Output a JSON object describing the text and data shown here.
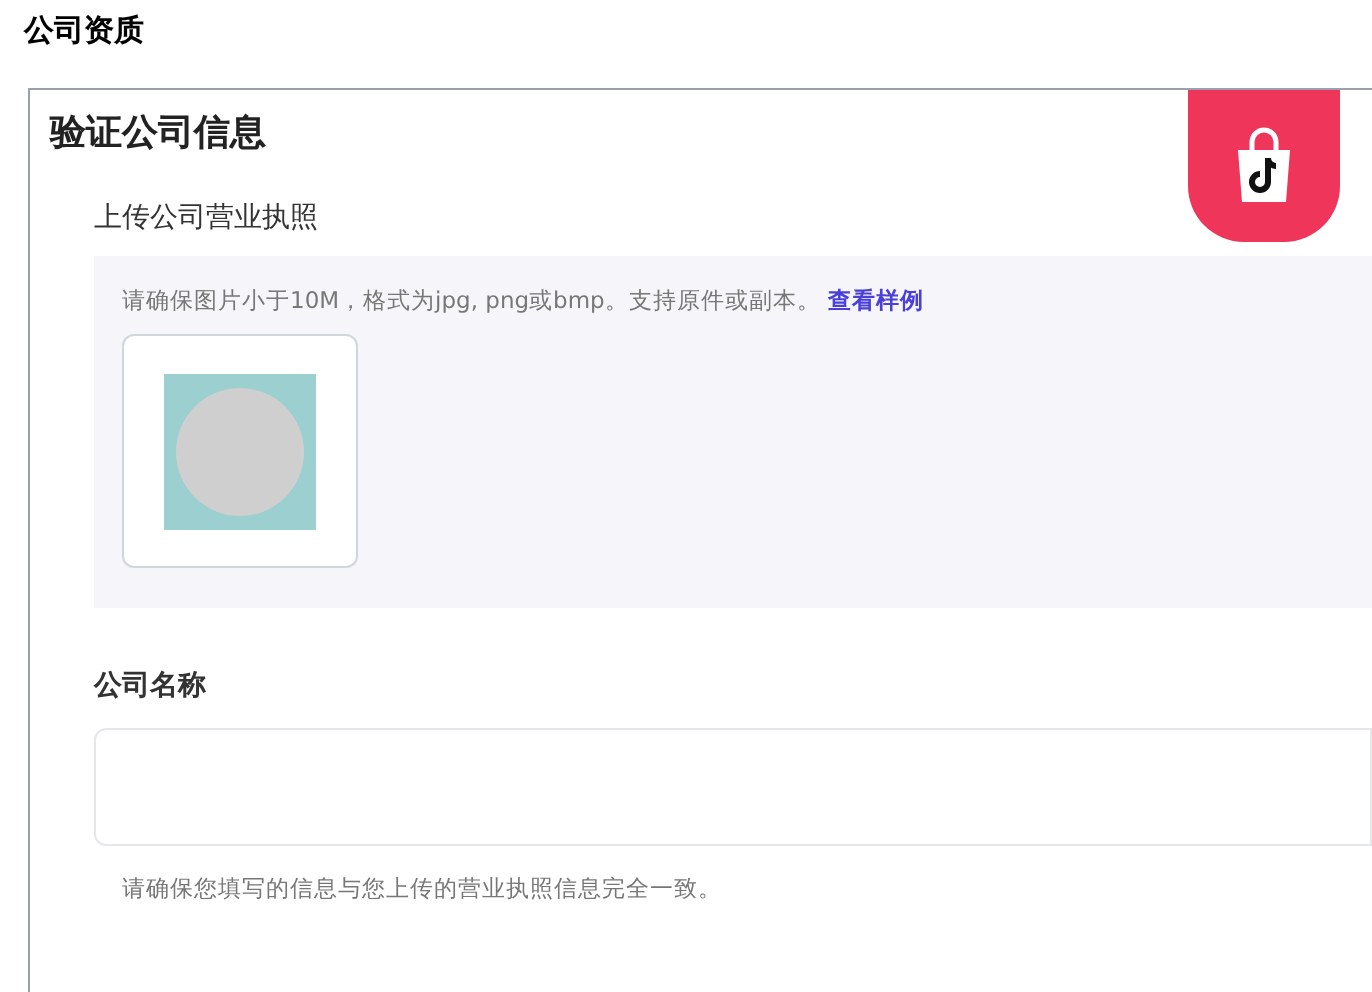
{
  "page_title": "公司资质",
  "card": {
    "title": "验证公司信息",
    "upload_section": {
      "label": "上传公司营业执照",
      "hint": "请确保图片小于10M，格式为jpg, png或bmp。支持原件或副本。",
      "link": "查看样例"
    },
    "company_name": {
      "label": "公司名称",
      "hint": "请确保您填写的信息与您上传的营业执照信息完全一致。"
    }
  }
}
